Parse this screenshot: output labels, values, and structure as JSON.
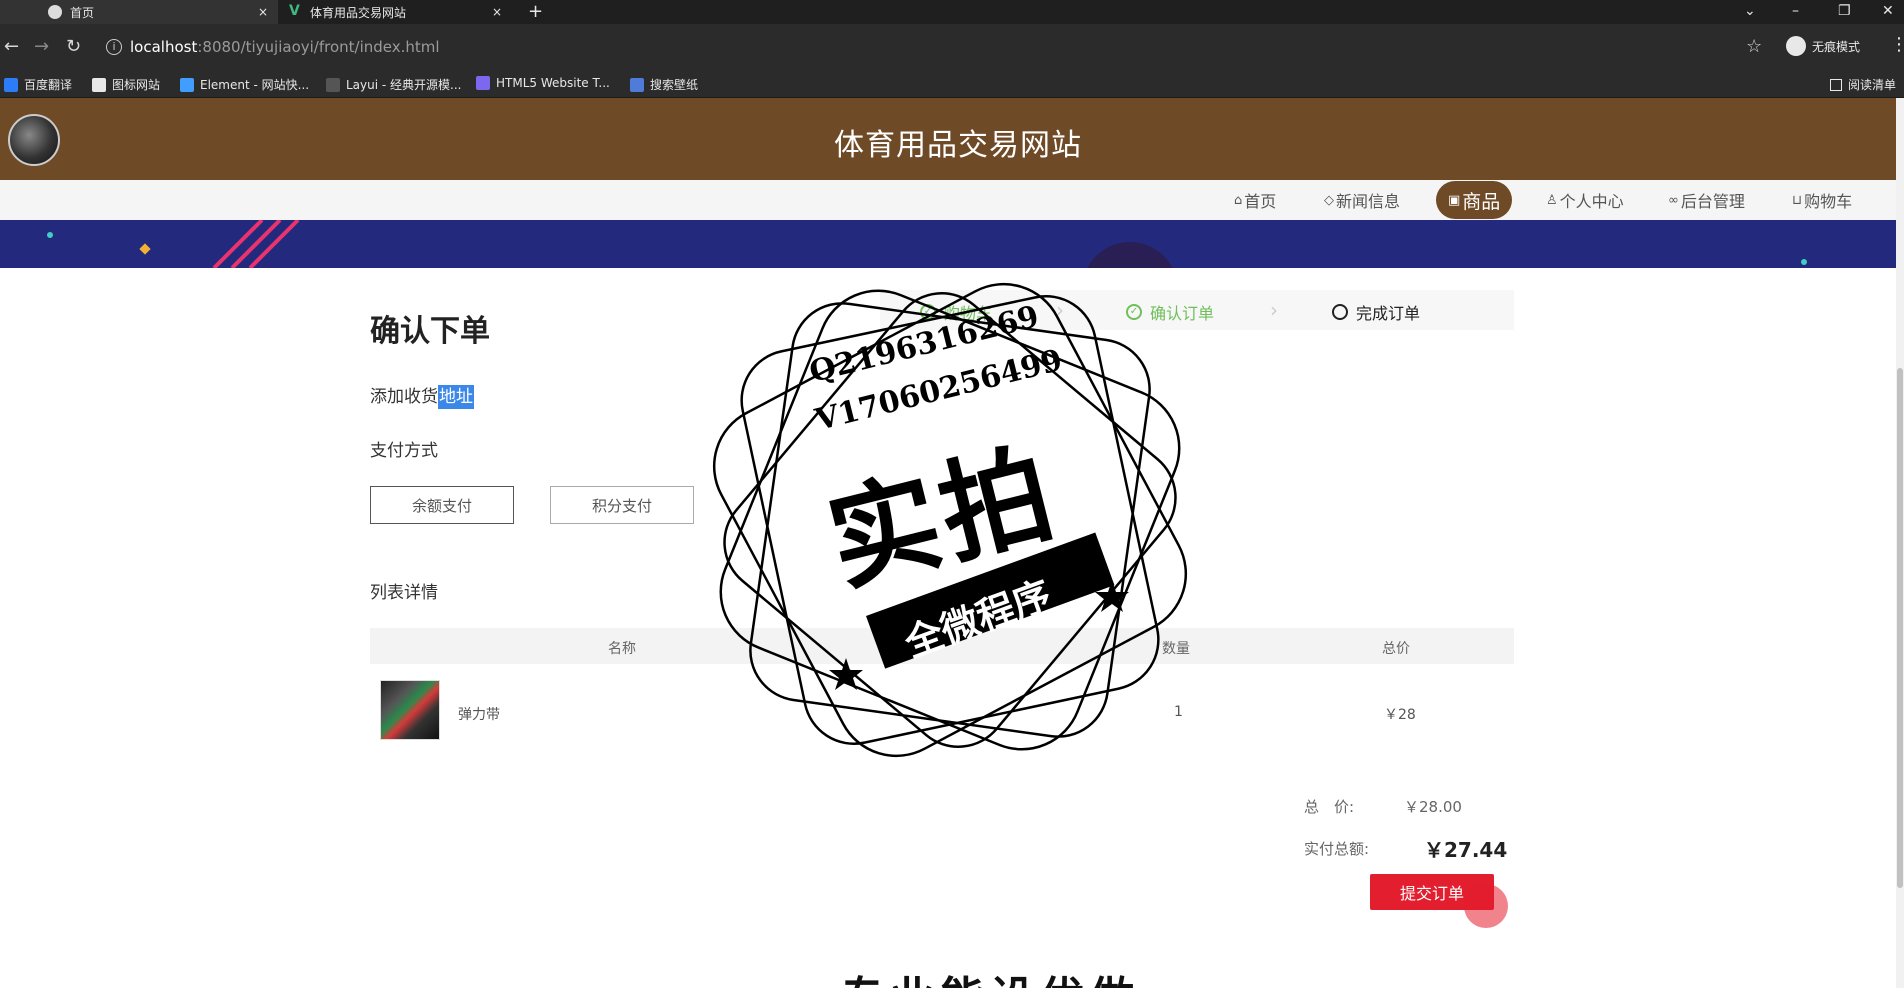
{
  "browser": {
    "tabs": [
      {
        "label": "首页",
        "close": "×"
      },
      {
        "label": "体育用品交易网站",
        "close": "×"
      }
    ],
    "new_tab": "+",
    "url_host": "localhost",
    "url_path": ":8080/tiyujiaoyi/front/index.html",
    "incognito_label": "无痕模式",
    "window_controls": {
      "menu": "⌄",
      "minimize": "–",
      "restore": "❐",
      "close": "✕"
    },
    "bookmarks": [
      {
        "label": "百度翻译",
        "color": "#2b7cf6"
      },
      {
        "label": "图标网站",
        "color": "#e8e8e8"
      },
      {
        "label": "Element - 网站快...",
        "color": "#409eff"
      },
      {
        "label": "Layui - 经典开源模...",
        "color": "#e8e8e8"
      },
      {
        "label": "HTML5 Website T...",
        "color": "#7b68ee"
      },
      {
        "label": "搜索壁纸",
        "color": "#4f7bd9"
      }
    ],
    "reading_list": "阅读清单"
  },
  "site": {
    "title": "体育用品交易网站",
    "brand_color": "#6f4a27",
    "nav": [
      {
        "label": "首页",
        "icon": "home-icon",
        "active": false
      },
      {
        "label": "新闻信息",
        "icon": "tag-icon",
        "active": false
      },
      {
        "label": "商品",
        "icon": "gift-icon",
        "active": true
      },
      {
        "label": "个人中心",
        "icon": "user-icon",
        "active": false
      },
      {
        "label": "后台管理",
        "icon": "link-icon",
        "active": false
      },
      {
        "label": "购物车",
        "icon": "cart-icon",
        "active": false
      }
    ]
  },
  "order": {
    "heading": "确认下单",
    "steps": [
      {
        "label": "购物车",
        "state": "done"
      },
      {
        "label": "确认订单",
        "state": "done"
      },
      {
        "label": "完成订单",
        "state": "current"
      }
    ],
    "address_prefix": "添加收货",
    "address_link": "地址",
    "payment_label": "支付方式",
    "payment_options": [
      "余额支付",
      "积分支付"
    ],
    "list_label": "列表详情",
    "columns": [
      "名称",
      "数量",
      "总价"
    ],
    "items": [
      {
        "name": "弹力带",
        "quantity": "1",
        "total": "￥28"
      }
    ],
    "summary": {
      "total_label": "总　价:",
      "total_value": "￥28.00",
      "paid_label": "实付总额:",
      "paid_value": "￥27.44"
    },
    "submit_label": "提交订单"
  },
  "footer_partial": "专业能设优做",
  "watermark": {
    "line1": "Q2196316269",
    "line2": "V17060256499",
    "big": "实拍",
    "ribbon": "全微程序"
  }
}
